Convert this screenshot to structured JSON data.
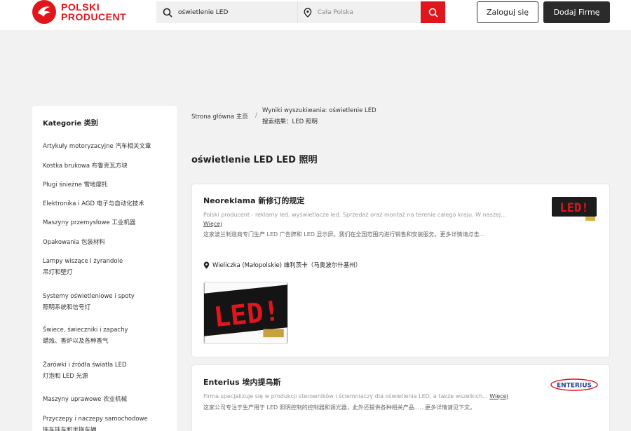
{
  "header": {
    "logo_line1": "POLSKI",
    "logo_line2": "PRODUCENT",
    "search_value": "oświetlenie LED",
    "location_placeholder": "Cała Polska",
    "login_label": "Zaloguj się",
    "add_company_label": "Dodaj Firmę"
  },
  "sidebar": {
    "title": "Kategorie 类别",
    "items": [
      {
        "label": "Artykuły motoryzacyjne 汽车相关文章"
      },
      {
        "label": "Kostka brukowa 布鲁克瓦方块"
      },
      {
        "label": "Pługi śnieżne 雪地摩托"
      },
      {
        "label": "Elektronika i AGD 电子与自动化技术"
      },
      {
        "label": "Maszyny przemysłowe 工业机器"
      },
      {
        "label": "Opakowania 包装材料"
      },
      {
        "label": "Lampy wiszące i żyrandole",
        "label2": "吊灯和壁灯"
      },
      {
        "label": "Systemy oświetleniowe i spoty",
        "label2": "照明系统和信号灯"
      },
      {
        "label": "Świece, świeczniki i zapachy",
        "label2": "蜡烛、香炉以及各种香气"
      },
      {
        "label": "Żarówki i źródła światła LED",
        "label2": "灯泡和 LED 光源"
      },
      {
        "label": "Maszyny uprawowe 农业机械"
      },
      {
        "label": "Przyczepy i naczepy samochodowe",
        "label2": "拖车挂车和半拖车辆"
      }
    ]
  },
  "breadcrumb": {
    "home": "Strona główna 主页",
    "separator": "/",
    "current_line1": "Wyniki wyszukiwania: oświetlenie LED",
    "current_line2": "搜索结果：LED 照明"
  },
  "page_title": "oświetlenie LED LED 照明",
  "results": [
    {
      "name": "Neoreklama 新修订的规定",
      "description": "Polski producent - reklamy led, wyświetlacze led. Sprzedaż oraz montaż na terenie całego kraju. W naszej...",
      "more": "Więcej",
      "description_cn": "这家波兰制造商专门生产 LED 广告牌和 LED 显示屏。我们在全国范围内进行销售和安装服务。更多详情请点击...",
      "location": "Wieliczka (Małopolskie) 维利茨卡（马奥波尔什基州）",
      "logo_text": "LED!",
      "photo_text": "LED!"
    },
    {
      "name": "Enterius 埃内提乌斯",
      "description": "Firma specjalizuje się w produkcji sterowników i ściemniaczy dla oświetlenia LED, a także wszelkich...",
      "more": "Więcej",
      "description_cn": "这家公司专注于生产用于 LED 照明控制的控制器和调光器，此外还提供各种相关产品......更多详情请见下文。",
      "logo_text": "ENTERIUS"
    }
  ],
  "colors": {
    "brand_red": "#e0161c",
    "dark_button": "#2b2b2b",
    "page_bg": "#f2f2f2"
  }
}
